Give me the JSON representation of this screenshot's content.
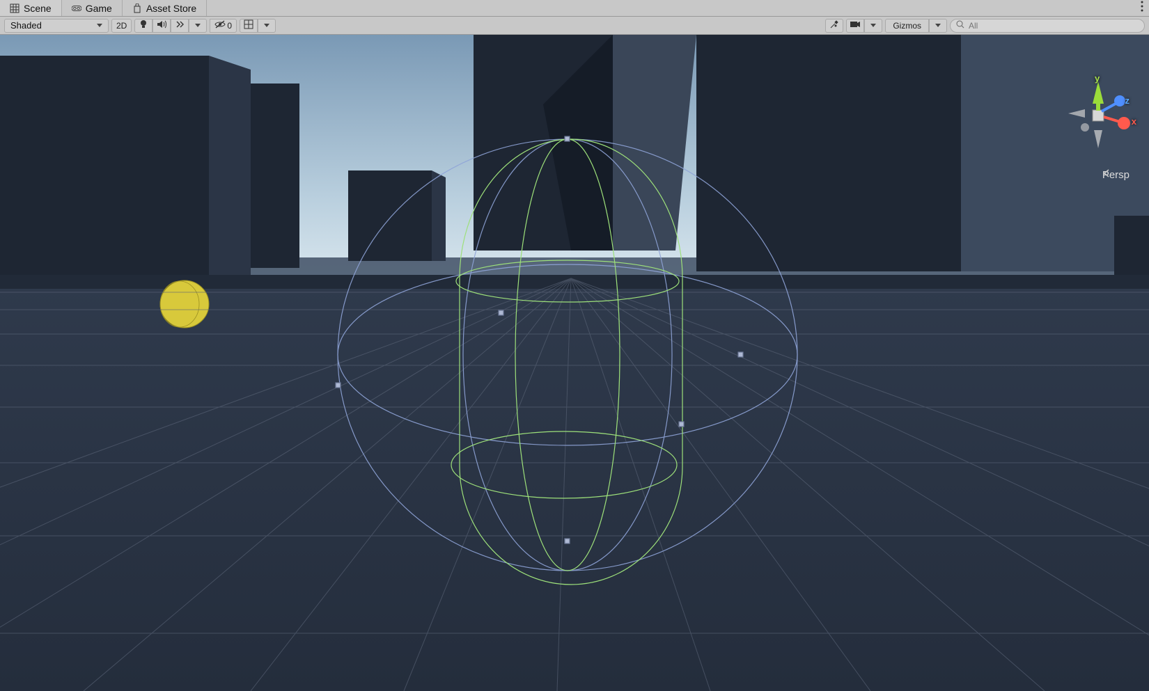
{
  "tabs": [
    {
      "label": "Scene",
      "icon": "grid",
      "active": true
    },
    {
      "label": "Game",
      "icon": "goggles",
      "active": false
    },
    {
      "label": "Asset Store",
      "icon": "bag",
      "active": false
    }
  ],
  "toolbar": {
    "shading_mode": "Shaded",
    "btn_2d": "2D",
    "hidden_count": "0",
    "gizmos_label": "Gizmos"
  },
  "search": {
    "placeholder": "All",
    "value": ""
  },
  "orientation": {
    "axis_x": "x",
    "axis_y": "y",
    "axis_z": "z",
    "projection": "Persp"
  },
  "scene": {
    "selected_object": "CharacterController capsule wireframe",
    "collider_color": "#9de07a",
    "selection_color": "#8fa4d8",
    "sun_gizmo_color": "#d8c93b",
    "ground_color": "#2a3445",
    "grid_color": "#5b6578",
    "sky_top": "#7a99b5",
    "sky_bottom": "#cfe1ea",
    "building_lit": "#4a5566",
    "building_shadow": "#1e2633"
  }
}
